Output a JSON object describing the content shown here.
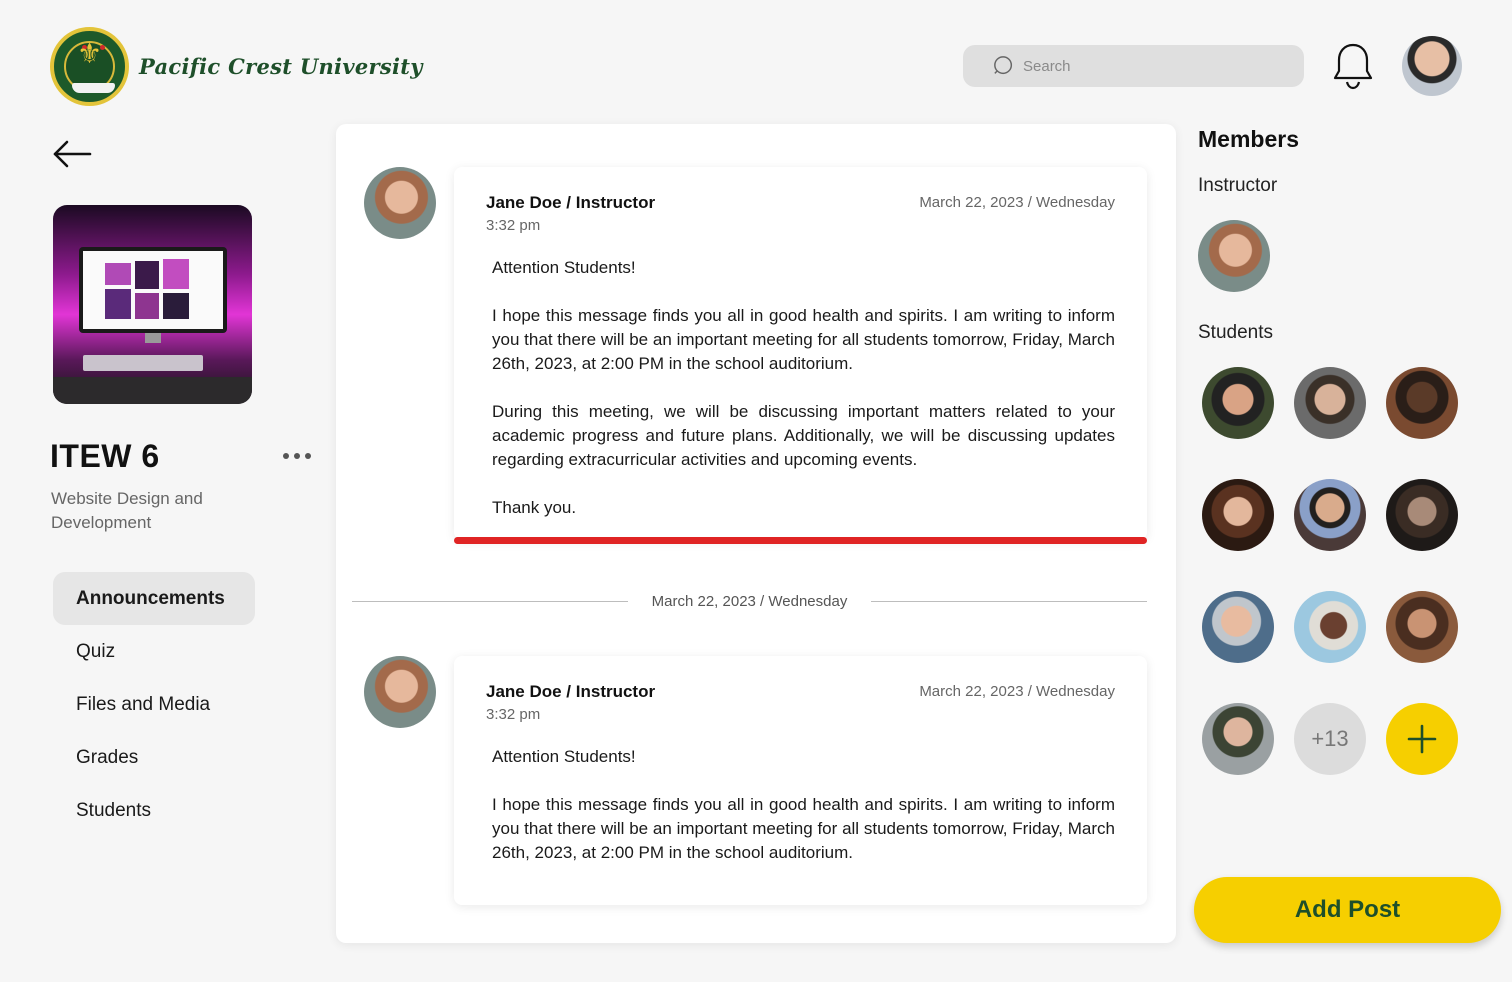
{
  "header": {
    "university_name": "Pacific Crest University",
    "search_placeholder": "Search",
    "icons": [
      "university-seal-icon",
      "search-icon",
      "bell-icon",
      "user-avatar"
    ]
  },
  "sidebar": {
    "back_icon": "arrow-left-icon",
    "course_code": "ITEW 6",
    "course_name": "Website Design and Development",
    "more_icon": "more-horizontal-icon",
    "nav": [
      {
        "label": "Announcements",
        "active": true
      },
      {
        "label": "Quiz",
        "active": false
      },
      {
        "label": "Files and Media",
        "active": false
      },
      {
        "label": "Grades",
        "active": false
      },
      {
        "label": "Students",
        "active": false
      }
    ]
  },
  "feed": {
    "divider_label": "March 22, 2023 / Wednesday",
    "posts": [
      {
        "author": "Jane Doe / Instructor",
        "time": "3:32 pm",
        "date": "March 22, 2023 / Wednesday",
        "paragraphs": [
          "Attention Students!",
          "I hope this message finds you all in good health and spirits. I am writing to inform you that there will be an important meeting for all students tomorrow, Friday, March 26th, 2023, at 2:00 PM in the school auditorium.",
          "During this meeting, we will be discussing important matters related to your academic progress and future plans. Additionally, we will be discussing updates regarding extracurricular activities and upcoming events.",
          "Thank you."
        ]
      },
      {
        "author": "Jane Doe / Instructor",
        "time": "3:32 pm",
        "date": "March 22, 2023 / Wednesday",
        "paragraphs": [
          "Attention Students!",
          "I hope this message finds you all in good health and spirits. I am writing to inform you that there will be an important meeting for all students tomorrow, Friday, March 26th, 2023, at 2:00 PM in the school auditorium."
        ]
      }
    ]
  },
  "members": {
    "title": "Members",
    "instructor_label": "Instructor",
    "students_label": "Students",
    "more_count": "+13",
    "add_icon": "plus-icon",
    "add_post_label": "Add Post"
  },
  "colors": {
    "accent_yellow": "#f6cf00",
    "brand_green": "#1e4f2a",
    "alert_red": "#e02424"
  }
}
